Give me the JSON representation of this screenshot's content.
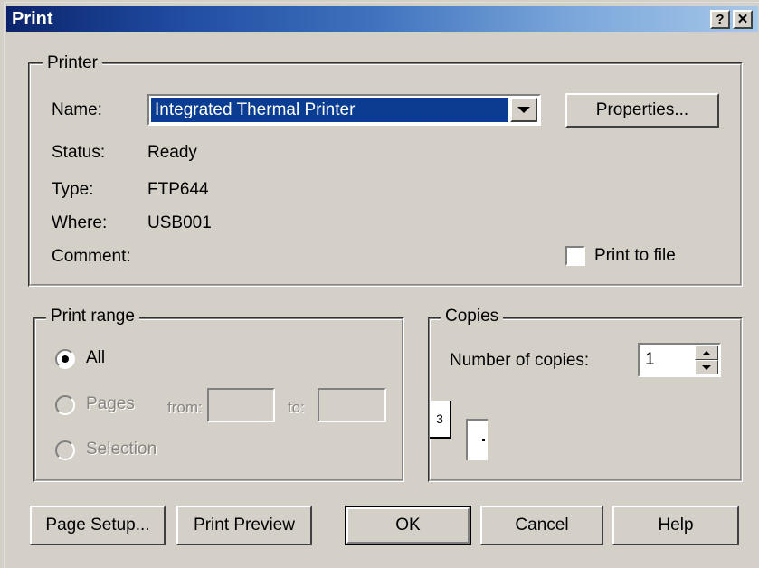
{
  "window": {
    "title": "Print",
    "help_button": "?",
    "close_button": "✕"
  },
  "printer_group": {
    "legend": "Printer",
    "name_label": "Name:",
    "name_value": "Integrated Thermal Printer",
    "properties_button": "Properties...",
    "status_label": "Status:",
    "status_value": "Ready",
    "type_label": "Type:",
    "type_value": "FTP644",
    "where_label": "Where:",
    "where_value": "USB001",
    "comment_label": "Comment:",
    "comment_value": "",
    "print_to_file_label": "Print to file",
    "print_to_file_checked": false
  },
  "print_range_group": {
    "legend": "Print range",
    "all_label": "All",
    "all_selected": true,
    "pages_label": "Pages",
    "pages_selected": false,
    "pages_enabled": false,
    "from_label": "from:",
    "from_value": "",
    "to_label": "to:",
    "to_value": "",
    "selection_label": "Selection",
    "selection_selected": false,
    "selection_enabled": false
  },
  "copies_group": {
    "legend": "Copies",
    "number_label": "Number of copies:",
    "number_value": "1",
    "collate_page_number": "3"
  },
  "footer_buttons": {
    "page_setup": "Page Setup...",
    "print_preview": "Print Preview",
    "ok": "OK",
    "cancel": "Cancel",
    "help": "Help"
  },
  "colors": {
    "dialog_face": "#d4d0c8",
    "titlebar_start": "#0a246a",
    "titlebar_end": "#a6c8ea",
    "selection_blue": "#0a3c91",
    "disabled_text": "#888480"
  }
}
